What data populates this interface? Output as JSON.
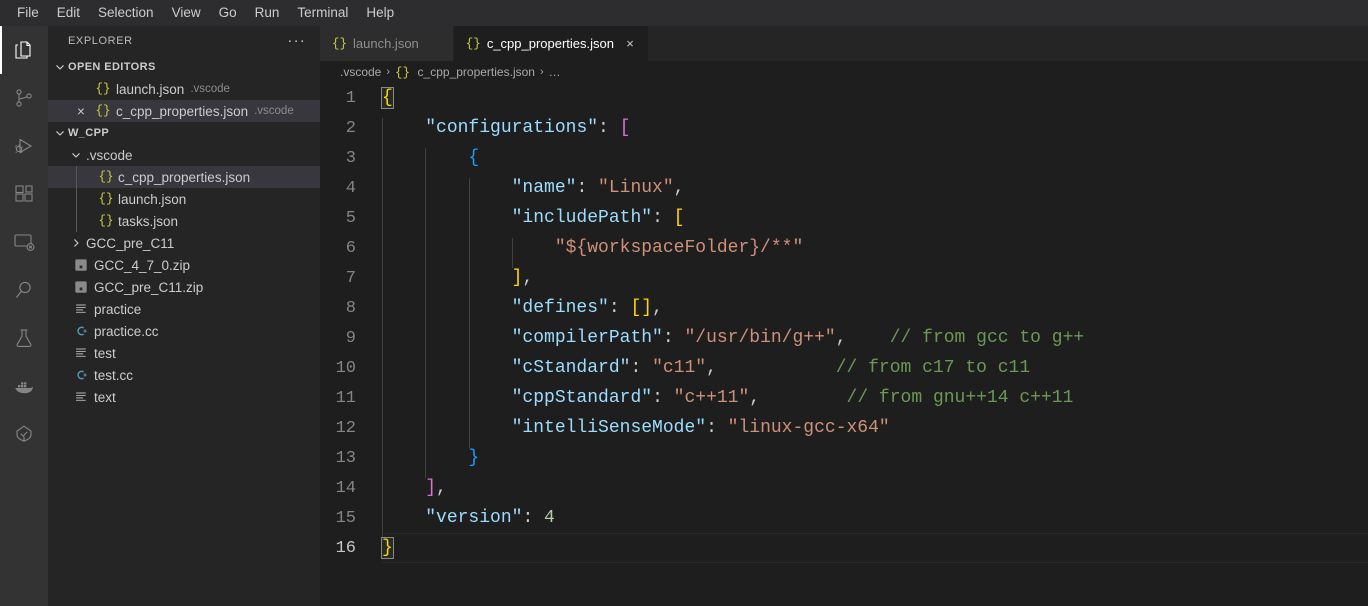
{
  "menubar": {
    "items": [
      "File",
      "Edit",
      "Selection",
      "View",
      "Go",
      "Run",
      "Terminal",
      "Help"
    ]
  },
  "activitybar": {
    "items": [
      {
        "name": "explorer",
        "icon": "files-icon",
        "active": true
      },
      {
        "name": "source-control",
        "icon": "source-control-icon",
        "active": false
      },
      {
        "name": "run-and-debug",
        "icon": "run-debug-icon",
        "active": false
      },
      {
        "name": "extensions",
        "icon": "extensions-icon",
        "active": false
      },
      {
        "name": "remote-explorer",
        "icon": "remote-explorer-icon",
        "active": false
      },
      {
        "name": "search",
        "icon": "search-icon",
        "active": false
      },
      {
        "name": "testing",
        "icon": "beaker-icon",
        "active": false
      },
      {
        "name": "docker",
        "icon": "docker-whale-icon",
        "active": false
      },
      {
        "name": "dependency-analytics",
        "icon": "tree-check-icon",
        "active": false
      }
    ]
  },
  "sidebar": {
    "title": "EXPLORER",
    "more_label": "···",
    "open_editors": {
      "label": "Open Editors",
      "items": [
        {
          "icon": "json-icon",
          "name": "launch.json",
          "description": ".vscode",
          "selected": false,
          "has_close": false
        },
        {
          "icon": "json-icon",
          "name": "c_cpp_properties.json",
          "description": ".vscode",
          "selected": true,
          "has_close": true,
          "close_label": "×"
        }
      ]
    },
    "workspace": {
      "label": "W_CPP",
      "items": [
        {
          "icon": "folder-open-icon",
          "name": ".vscode",
          "depth": 1,
          "kind": "folder",
          "expanded": true,
          "selected": false
        },
        {
          "icon": "json-icon",
          "name": "c_cpp_properties.json",
          "depth": 2,
          "kind": "file",
          "selected": true
        },
        {
          "icon": "json-icon",
          "name": "launch.json",
          "depth": 2,
          "kind": "file",
          "selected": false
        },
        {
          "icon": "json-icon",
          "name": "tasks.json",
          "depth": 2,
          "kind": "file",
          "selected": false
        },
        {
          "icon": "folder-collapsed-icon",
          "name": "GCC_pre_C11",
          "depth": 1,
          "kind": "folder",
          "expanded": false,
          "selected": false
        },
        {
          "icon": "zip-icon",
          "name": "GCC_4_7_0.zip",
          "depth": 1,
          "kind": "file",
          "selected": false
        },
        {
          "icon": "zip-icon",
          "name": "GCC_pre_C11.zip",
          "depth": 1,
          "kind": "file",
          "selected": false
        },
        {
          "icon": "text-file-icon",
          "name": "practice",
          "depth": 1,
          "kind": "file",
          "selected": false
        },
        {
          "icon": "cpp-icon",
          "name": "practice.cc",
          "depth": 1,
          "kind": "file",
          "selected": false
        },
        {
          "icon": "text-file-icon",
          "name": "test",
          "depth": 1,
          "kind": "file",
          "selected": false
        },
        {
          "icon": "cpp-icon",
          "name": "test.cc",
          "depth": 1,
          "kind": "file",
          "selected": false
        },
        {
          "icon": "text-file-icon",
          "name": "text",
          "depth": 1,
          "kind": "file",
          "selected": false
        }
      ]
    }
  },
  "tabs": [
    {
      "icon": "json-icon",
      "label": "launch.json",
      "active": false,
      "close_label": "×"
    },
    {
      "icon": "json-icon",
      "label": "c_cpp_properties.json",
      "active": true,
      "close_label": "×"
    }
  ],
  "breadcrumbs": {
    "separator": "›",
    "items": [
      {
        "label": ".vscode",
        "icon": null
      },
      {
        "label": "c_cpp_properties.json",
        "icon": "json-icon"
      },
      {
        "label": "…",
        "icon": null
      }
    ]
  },
  "editor": {
    "language": "json",
    "current_line": 16,
    "lines": [
      {
        "n": 1,
        "guides": 0,
        "tokens": [
          {
            "t": "{",
            "c": "tk-b0 bmatch"
          }
        ]
      },
      {
        "n": 2,
        "guides": 1,
        "tokens": [
          {
            "t": "    ",
            "c": "tk-punc"
          },
          {
            "t": "\"configurations\"",
            "c": "tk-prop"
          },
          {
            "t": ": ",
            "c": "tk-punc"
          },
          {
            "t": "[",
            "c": "tk-b1"
          }
        ]
      },
      {
        "n": 3,
        "guides": 2,
        "tokens": [
          {
            "t": "        ",
            "c": "tk-punc"
          },
          {
            "t": "{",
            "c": "tk-b2"
          }
        ]
      },
      {
        "n": 4,
        "guides": 3,
        "tokens": [
          {
            "t": "            ",
            "c": "tk-punc"
          },
          {
            "t": "\"name\"",
            "c": "tk-prop"
          },
          {
            "t": ": ",
            "c": "tk-punc"
          },
          {
            "t": "\"Linux\"",
            "c": "tk-str"
          },
          {
            "t": ",",
            "c": "tk-punc"
          }
        ]
      },
      {
        "n": 5,
        "guides": 3,
        "tokens": [
          {
            "t": "            ",
            "c": "tk-punc"
          },
          {
            "t": "\"includePath\"",
            "c": "tk-prop"
          },
          {
            "t": ": ",
            "c": "tk-punc"
          },
          {
            "t": "[",
            "c": "tk-b0"
          }
        ]
      },
      {
        "n": 6,
        "guides": 4,
        "tokens": [
          {
            "t": "                ",
            "c": "tk-punc"
          },
          {
            "t": "\"${workspaceFolder}/**\"",
            "c": "tk-str"
          }
        ]
      },
      {
        "n": 7,
        "guides": 3,
        "tokens": [
          {
            "t": "            ",
            "c": "tk-punc"
          },
          {
            "t": "]",
            "c": "tk-b0"
          },
          {
            "t": ",",
            "c": "tk-punc"
          }
        ]
      },
      {
        "n": 8,
        "guides": 3,
        "tokens": [
          {
            "t": "            ",
            "c": "tk-punc"
          },
          {
            "t": "\"defines\"",
            "c": "tk-prop"
          },
          {
            "t": ": ",
            "c": "tk-punc"
          },
          {
            "t": "[]",
            "c": "tk-b0"
          },
          {
            "t": ",",
            "c": "tk-punc"
          }
        ]
      },
      {
        "n": 9,
        "guides": 3,
        "tokens": [
          {
            "t": "            ",
            "c": "tk-punc"
          },
          {
            "t": "\"compilerPath\"",
            "c": "tk-prop"
          },
          {
            "t": ": ",
            "c": "tk-punc"
          },
          {
            "t": "\"/usr/bin/g++\"",
            "c": "tk-str"
          },
          {
            "t": ",",
            "c": "tk-punc"
          },
          {
            "t": "    ",
            "c": "tk-punc"
          },
          {
            "t": "// from gcc to g++",
            "c": "tk-cmt"
          }
        ]
      },
      {
        "n": 10,
        "guides": 3,
        "tokens": [
          {
            "t": "            ",
            "c": "tk-punc"
          },
          {
            "t": "\"cStandard\"",
            "c": "tk-prop"
          },
          {
            "t": ": ",
            "c": "tk-punc"
          },
          {
            "t": "\"c11\"",
            "c": "tk-str"
          },
          {
            "t": ",",
            "c": "tk-punc"
          },
          {
            "t": "           ",
            "c": "tk-punc"
          },
          {
            "t": "// from c17 to c11",
            "c": "tk-cmt"
          }
        ]
      },
      {
        "n": 11,
        "guides": 3,
        "tokens": [
          {
            "t": "            ",
            "c": "tk-punc"
          },
          {
            "t": "\"cppStandard\"",
            "c": "tk-prop"
          },
          {
            "t": ": ",
            "c": "tk-punc"
          },
          {
            "t": "\"c++11\"",
            "c": "tk-str"
          },
          {
            "t": ",",
            "c": "tk-punc"
          },
          {
            "t": "        ",
            "c": "tk-punc"
          },
          {
            "t": "// from gnu++14 c++11",
            "c": "tk-cmt"
          }
        ]
      },
      {
        "n": 12,
        "guides": 3,
        "tokens": [
          {
            "t": "            ",
            "c": "tk-punc"
          },
          {
            "t": "\"intelliSenseMode\"",
            "c": "tk-prop"
          },
          {
            "t": ": ",
            "c": "tk-punc"
          },
          {
            "t": "\"linux-gcc-x64\"",
            "c": "tk-str"
          }
        ]
      },
      {
        "n": 13,
        "guides": 2,
        "tokens": [
          {
            "t": "        ",
            "c": "tk-punc"
          },
          {
            "t": "}",
            "c": "tk-b2"
          }
        ]
      },
      {
        "n": 14,
        "guides": 1,
        "tokens": [
          {
            "t": "    ",
            "c": "tk-punc"
          },
          {
            "t": "]",
            "c": "tk-b1"
          },
          {
            "t": ",",
            "c": "tk-punc"
          }
        ]
      },
      {
        "n": 15,
        "guides": 1,
        "tokens": [
          {
            "t": "    ",
            "c": "tk-punc"
          },
          {
            "t": "\"version\"",
            "c": "tk-prop"
          },
          {
            "t": ": ",
            "c": "tk-punc"
          },
          {
            "t": "4",
            "c": "tk-num"
          }
        ]
      },
      {
        "n": 16,
        "guides": 0,
        "tokens": [
          {
            "t": "}",
            "c": "tk-b0 bmatch"
          }
        ]
      }
    ]
  },
  "colors": {
    "menubar_bg": "#2d2d30",
    "activitybar_bg": "#333333",
    "sidebar_bg": "#252526",
    "editor_bg": "#1e1e1e",
    "tab_active_bg": "#1e1e1e",
    "tab_inactive_bg": "#2d2d2d",
    "selection_bg": "#37373d",
    "foreground": "#cccccc",
    "line_number": "#858585",
    "json_icon": "#cbcb41",
    "cpp_icon": "#519aba",
    "property": "#9cdcfe",
    "string": "#ce9178",
    "number": "#b5cea8",
    "comment": "#6a9955",
    "bracket_level_0": "#ffd700",
    "bracket_level_1": "#da70d6",
    "bracket_level_2": "#179fff"
  }
}
